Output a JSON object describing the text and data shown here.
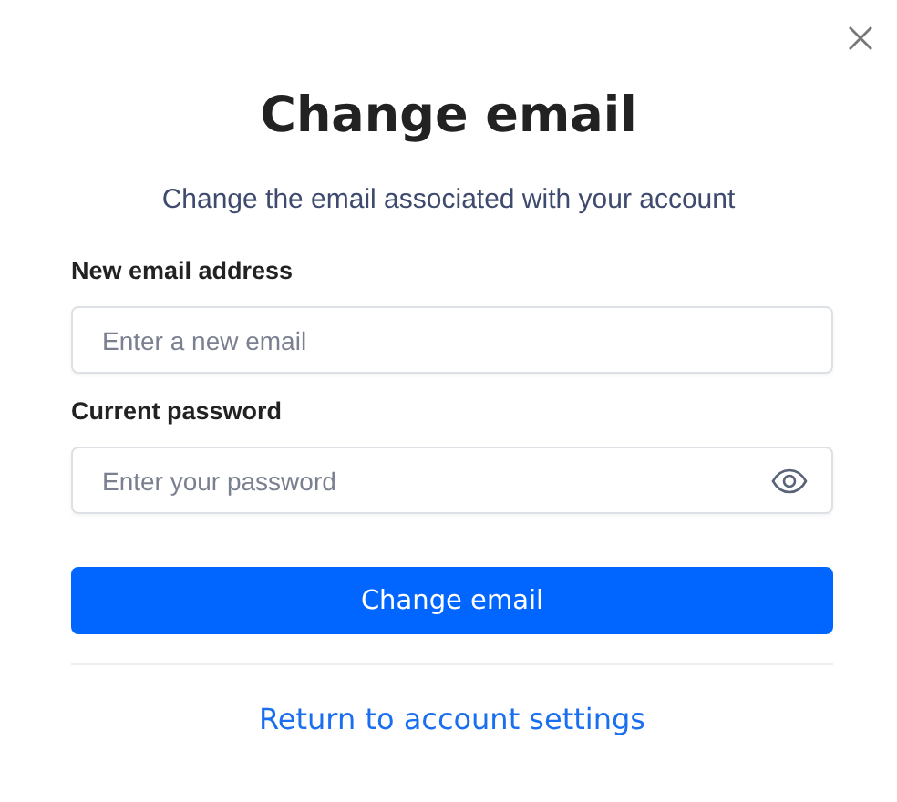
{
  "dialog": {
    "title": "Change email",
    "subtitle": "Change the email associated with your account"
  },
  "fields": [
    {
      "kind": "email",
      "label": "New email address",
      "placeholder": "Enter a new email"
    },
    {
      "kind": "password",
      "label": "Current password",
      "placeholder": "Enter your password"
    }
  ],
  "submit_button": "Change email",
  "return_link": "Return to account settings"
}
